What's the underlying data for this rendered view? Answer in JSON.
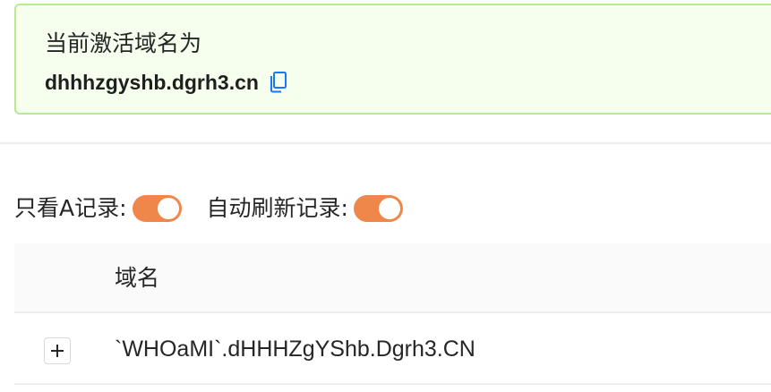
{
  "alert": {
    "title": "当前激活域名为",
    "domain": "dhhhzgyshb.dgrh3.cn",
    "copy_icon": "copy-icon",
    "color_accent": "#1677ff"
  },
  "toggles": {
    "only_a_records": {
      "label": "只看A记录:",
      "checked": true
    },
    "auto_refresh": {
      "label": "自动刷新记录:",
      "checked": true
    },
    "color_on": "#f0874a"
  },
  "table": {
    "columns": [
      "域名"
    ],
    "rows": [
      {
        "domain": "`WHOaMI`.dHHHZgYShb.Dgrh3.CN",
        "expand_icon": "plus-icon"
      }
    ]
  }
}
